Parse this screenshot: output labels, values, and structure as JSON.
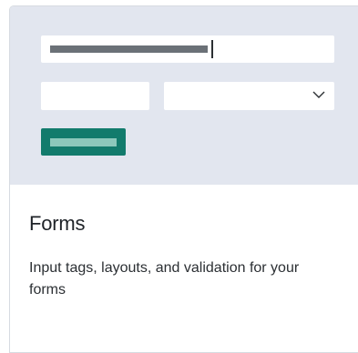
{
  "card": {
    "title": "Forms",
    "description": "Input tags, layouts, and validation for your forms"
  },
  "preview": {
    "background_color": "#e2e6ef",
    "button_color": "#127b6c",
    "select_icon": "chevron-down-icon"
  }
}
